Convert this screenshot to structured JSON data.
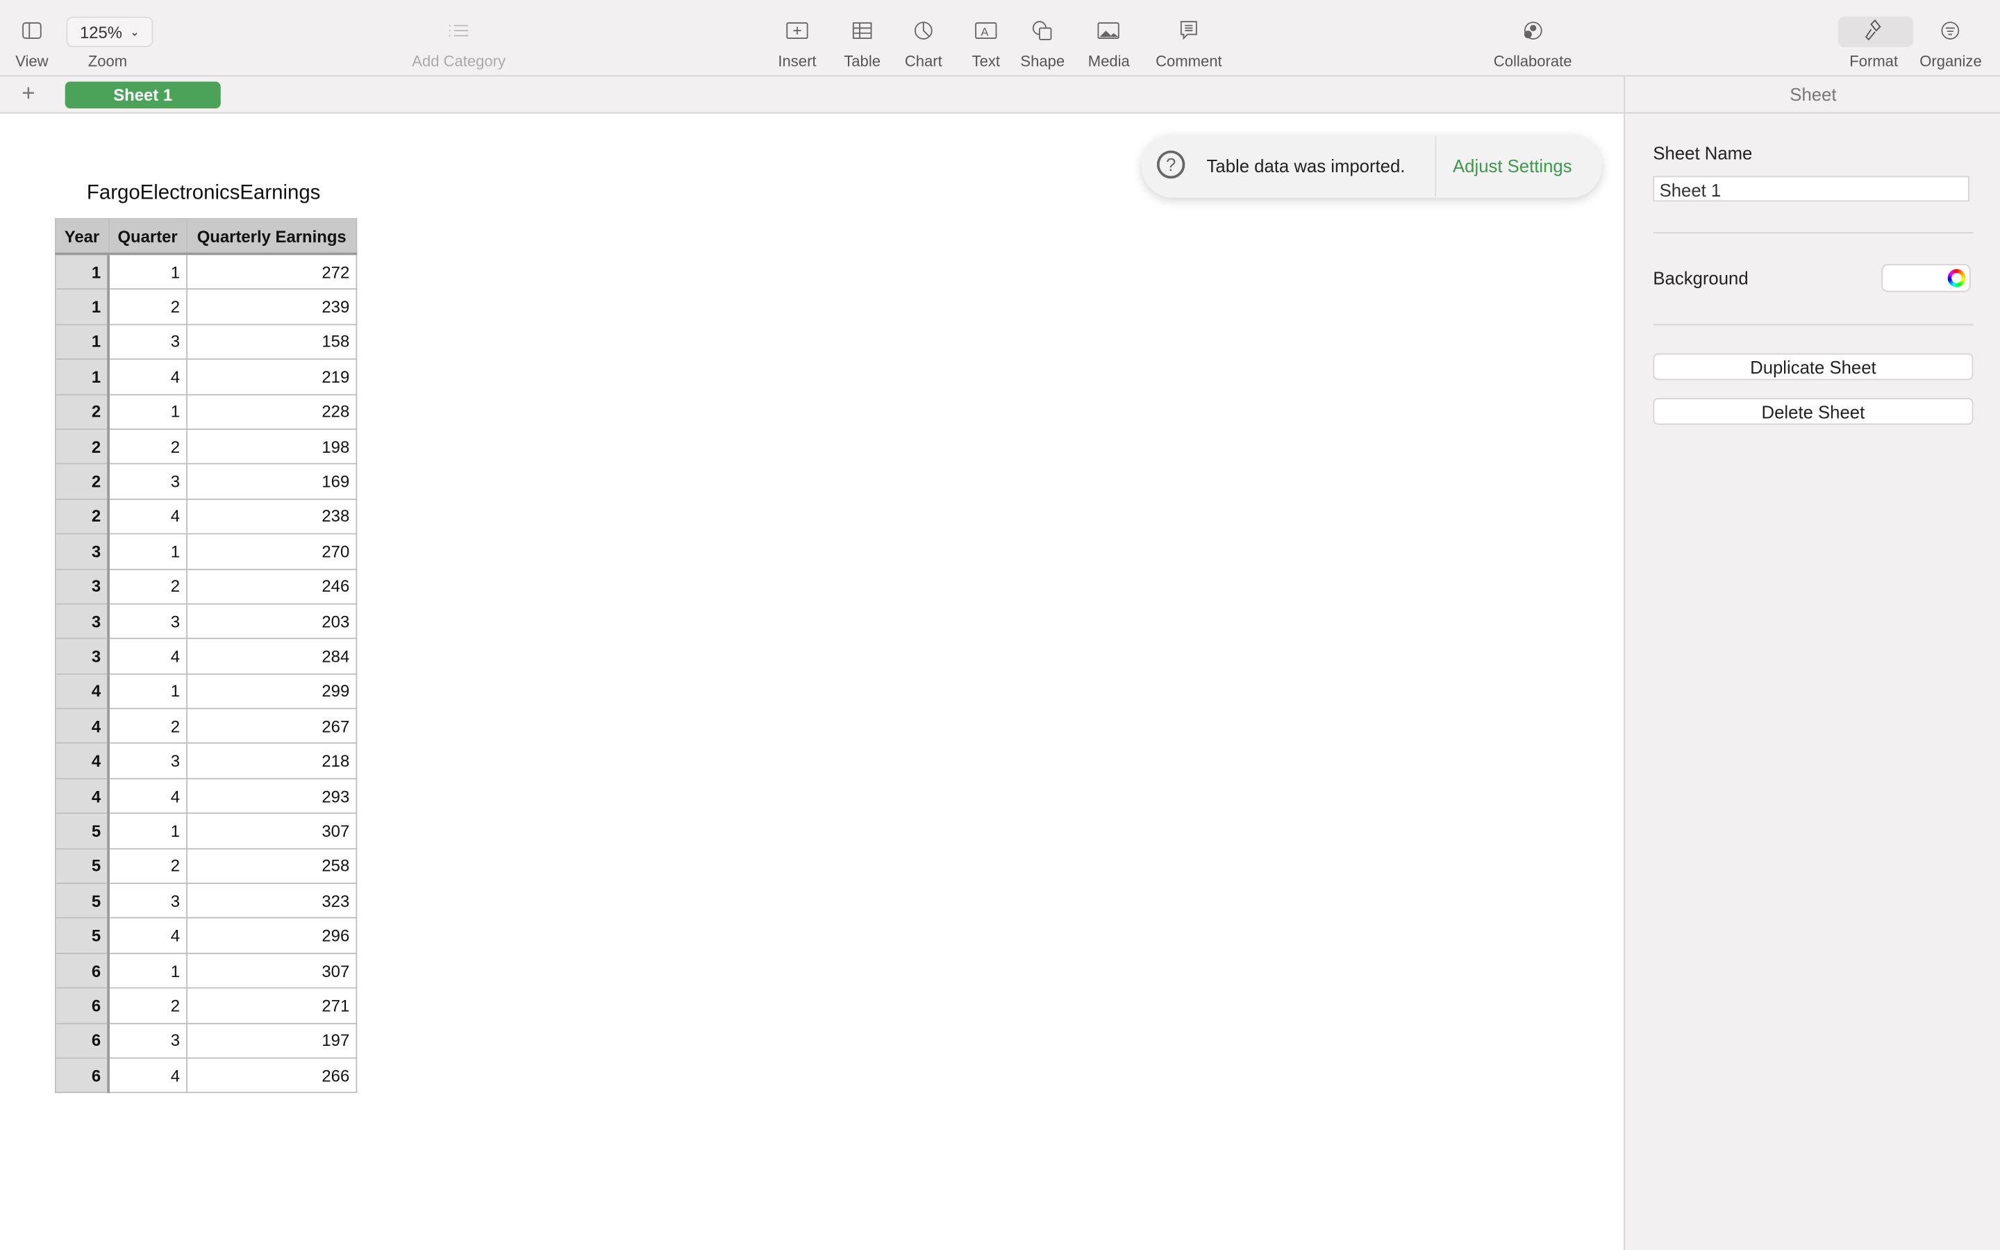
{
  "toolbar": {
    "view": "View",
    "zoom_label": "Zoom",
    "zoom_value": "125%",
    "add_category": "Add Category",
    "insert": "Insert",
    "table": "Table",
    "chart": "Chart",
    "text": "Text",
    "shape": "Shape",
    "media": "Media",
    "comment": "Comment",
    "collaborate": "Collaborate",
    "format": "Format",
    "organize": "Organize"
  },
  "tabs": {
    "sheet": "Sheet 1"
  },
  "toast": {
    "message": "Table data was imported.",
    "action": "Adjust Settings"
  },
  "table": {
    "title": "FargoElectronicsEarnings",
    "headers": [
      "Year",
      "Quarter",
      "Quarterly Earnings"
    ],
    "rows": [
      [
        "1",
        "1",
        "272"
      ],
      [
        "1",
        "2",
        "239"
      ],
      [
        "1",
        "3",
        "158"
      ],
      [
        "1",
        "4",
        "219"
      ],
      [
        "2",
        "1",
        "228"
      ],
      [
        "2",
        "2",
        "198"
      ],
      [
        "2",
        "3",
        "169"
      ],
      [
        "2",
        "4",
        "238"
      ],
      [
        "3",
        "1",
        "270"
      ],
      [
        "3",
        "2",
        "246"
      ],
      [
        "3",
        "3",
        "203"
      ],
      [
        "3",
        "4",
        "284"
      ],
      [
        "4",
        "1",
        "299"
      ],
      [
        "4",
        "2",
        "267"
      ],
      [
        "4",
        "3",
        "218"
      ],
      [
        "4",
        "4",
        "293"
      ],
      [
        "5",
        "1",
        "307"
      ],
      [
        "5",
        "2",
        "258"
      ],
      [
        "5",
        "3",
        "323"
      ],
      [
        "5",
        "4",
        "296"
      ],
      [
        "6",
        "1",
        "307"
      ],
      [
        "6",
        "2",
        "271"
      ],
      [
        "6",
        "3",
        "197"
      ],
      [
        "6",
        "4",
        "266"
      ]
    ]
  },
  "sidebar": {
    "header": "Sheet",
    "sheet_name_label": "Sheet Name",
    "sheet_name_value": "Sheet 1",
    "background_label": "Background",
    "duplicate": "Duplicate Sheet",
    "delete": "Delete Sheet"
  },
  "colors": {
    "accent": "#4ba35a",
    "link": "#3a9a4a"
  }
}
